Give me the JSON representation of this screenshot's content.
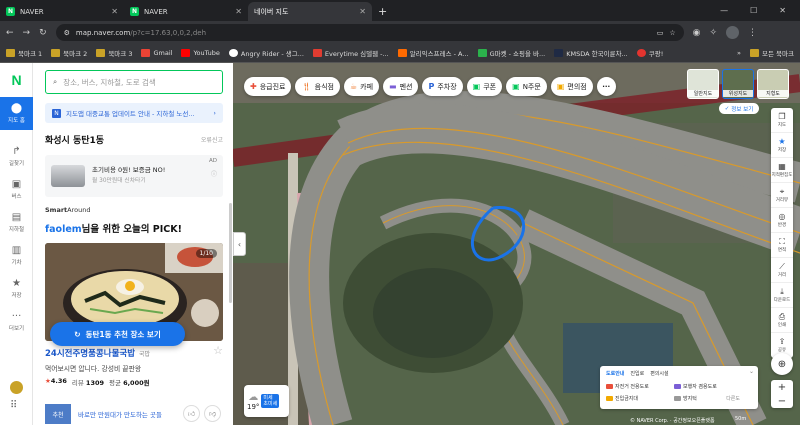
{
  "tabs": [
    {
      "title": "NAVER",
      "favicon": "N"
    },
    {
      "title": "NAVER",
      "favicon": "N"
    },
    {
      "title": "네이버 지도",
      "favicon": "N"
    }
  ],
  "address": {
    "domain": "map.naver.com",
    "path": "/p?c=17.63,0,0,2,deh"
  },
  "bookmarks": [
    {
      "label": "북마크 1",
      "icon": "folder-icon"
    },
    {
      "label": "북마크 2",
      "icon": "folder-icon"
    },
    {
      "label": "북마크 3",
      "icon": "folder-icon"
    },
    {
      "label": "Gmail",
      "icon": "gmail-icon"
    },
    {
      "label": "YouTube",
      "icon": "youtube-icon"
    },
    {
      "label": "Angry Rider - 생그...",
      "icon": "site-icon"
    },
    {
      "label": "Everytime 심델웹 -...",
      "icon": "everytime-icon"
    },
    {
      "label": "알리익스프레스 - A...",
      "icon": "aliexpress-icon"
    },
    {
      "label": "G마켓 - 쇼핑을 바...",
      "icon": "gmarket-icon"
    },
    {
      "label": "KMSDA 한국이륜차...",
      "icon": "site-icon"
    },
    {
      "label": "쿠팡!",
      "icon": "coupang-icon"
    }
  ],
  "bookmarks_all": "모든 북마크",
  "rail": [
    {
      "label": "지도 홈",
      "icon": "home-icon"
    },
    {
      "label": "길찾기",
      "icon": "directions-icon"
    },
    {
      "label": "버스",
      "icon": "bus-icon"
    },
    {
      "label": "지하철",
      "icon": "subway-icon"
    },
    {
      "label": "기차",
      "icon": "train-icon"
    },
    {
      "label": "저장",
      "icon": "star-icon"
    },
    {
      "label": "더보기",
      "icon": "more-icon"
    }
  ],
  "logo": "N",
  "search": {
    "placeholder": "장소, 버스, 지하철, 도로 검색"
  },
  "notice": "지도앱 대중교통 업데이트 안내 - 지하철 노선...",
  "location": {
    "name": "화성시 동탄1동",
    "report": "오류신고"
  },
  "ad": {
    "label": "AD",
    "line1": "초기비용 0원! 보증금 NO!",
    "line2": "월 30만원대 신차타기"
  },
  "smart_around": {
    "brand": "Smart",
    "suffix": "Around"
  },
  "pick": {
    "handle": "faolem",
    "text": "님을 위한 오늘의 PICK!"
  },
  "place": {
    "counter": "1/10",
    "name": "24시전주명품콩나물국밥",
    "category": "국밥",
    "desc": "먹어보시면 압니다. 강성비 끝판왕",
    "rating": "4.36",
    "review_label": "리뷰",
    "reviews": "1309",
    "price_label": "평균",
    "price": "6,000원"
  },
  "rec": {
    "thumb": "추천",
    "text": "바로만 만원대가 만도하는 곳들"
  },
  "fab": "동탄1동 추천 장소 보기",
  "chips": [
    {
      "label": "응급진료",
      "icon": "emergency-icon",
      "color": "#e94f3a"
    },
    {
      "label": "음식점",
      "icon": "fork-icon",
      "color": "#ef7b2f"
    },
    {
      "label": "카페",
      "icon": "cafe-icon",
      "color": "#ef7b2f"
    },
    {
      "label": "펜션",
      "icon": "bed-icon",
      "color": "#7b5fd6"
    },
    {
      "label": "주차장",
      "icon": "parking-icon",
      "color": "#2a64d6"
    },
    {
      "label": "쿠폰",
      "icon": "coupon-icon",
      "color": "#03c75a"
    },
    {
      "label": "N주문",
      "icon": "order-icon",
      "color": "#03c75a"
    },
    {
      "label": "편의점",
      "icon": "store-icon",
      "color": "#f2a900"
    }
  ],
  "maptypes": [
    {
      "label": "일반지도"
    },
    {
      "label": "위성지도"
    },
    {
      "label": "지형도"
    }
  ],
  "mapinfo": "정보 보기",
  "tools": [
    {
      "label": "지도",
      "icon": "layers-icon"
    },
    {
      "label": "저장",
      "icon": "star-icon"
    },
    {
      "label": "지적편집도",
      "icon": "cadastral-icon"
    },
    {
      "label": "거리뷰",
      "icon": "street-icon"
    },
    {
      "label": "반경",
      "icon": "radius-icon"
    },
    {
      "label": "면적",
      "icon": "area-icon"
    },
    {
      "label": "거리",
      "icon": "ruler-icon"
    },
    {
      "label": "다운로드",
      "icon": "download-icon"
    },
    {
      "label": "인쇄",
      "icon": "print-icon"
    },
    {
      "label": "공유",
      "icon": "share-icon"
    }
  ],
  "weather": {
    "temp": "19°",
    "aq1": "미세",
    "aq2": "초미세"
  },
  "legend": {
    "title": "도로안내",
    "tab2": "진입로",
    "tab3": "편의시설",
    "items": [
      {
        "label": "자전거 전용도로",
        "color": "#e94f3a"
      },
      {
        "label": "보행자 겸용도로",
        "color": "#7b5fd6"
      },
      {
        "label": "진입금지대",
        "color": "#f2a900"
      },
      {
        "label": "방지턱",
        "color": "#999999"
      }
    ],
    "more": "다른도"
  },
  "copyright": "© NAVER Corp. · 공간정보오픈플랫폼",
  "scale": "50m"
}
